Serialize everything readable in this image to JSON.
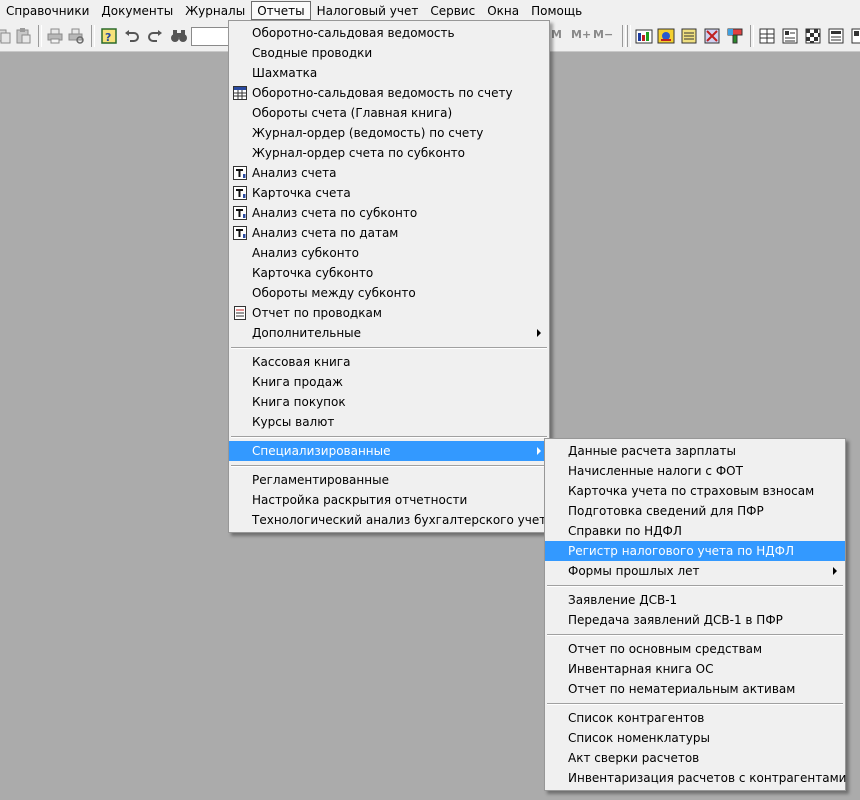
{
  "menubar": {
    "items": [
      {
        "label": "Справочники"
      },
      {
        "label": "Документы"
      },
      {
        "label": "Журналы"
      },
      {
        "label": "Отчеты"
      },
      {
        "label": "Налоговый учет"
      },
      {
        "label": "Сервис"
      },
      {
        "label": "Окна"
      },
      {
        "label": "Помощь"
      }
    ],
    "active": "Отчеты"
  },
  "toolbar": {
    "text_m": "M",
    "text_mplus": "M+",
    "text_mminus": "M−"
  },
  "reports_menu": {
    "items": [
      {
        "label": "Оборотно-сальдовая ведомость"
      },
      {
        "label": "Сводные проводки"
      },
      {
        "label": "Шахматка"
      },
      {
        "label": "Оборотно-сальдовая ведомость по счету",
        "icon": "table-icon"
      },
      {
        "label": "Обороты счета (Главная книга)"
      },
      {
        "label": "Журнал-ордер (ведомость) по счету"
      },
      {
        "label": "Журнал-ордер счета по субконто"
      },
      {
        "label": "Анализ счета",
        "icon": "report-t-icon"
      },
      {
        "label": "Карточка счета",
        "icon": "report-t-icon"
      },
      {
        "label": "Анализ счета по субконто",
        "icon": "report-t-icon"
      },
      {
        "label": "Анализ счета по датам",
        "icon": "report-t-icon"
      },
      {
        "label": "Анализ субконто"
      },
      {
        "label": "Карточка субконто"
      },
      {
        "label": "Обороты между субконто"
      },
      {
        "label": "Отчет по проводкам",
        "icon": "document-icon"
      },
      {
        "label": "Дополнительные",
        "submenu": true
      },
      {
        "separator": true
      },
      {
        "label": "Кассовая книга"
      },
      {
        "label": "Книга продаж"
      },
      {
        "label": "Книга покупок"
      },
      {
        "label": "Курсы валют"
      },
      {
        "separator": true
      },
      {
        "label": "Специализированные",
        "submenu": true,
        "selected": true
      },
      {
        "separator": true
      },
      {
        "label": "Регламентированные"
      },
      {
        "label": "Настройка раскрытия отчетности"
      },
      {
        "label": "Технологический анализ бухгалтерского учета"
      }
    ]
  },
  "specialized_menu": {
    "items": [
      {
        "label": "Данные расчета зарплаты"
      },
      {
        "label": "Начисленные налоги с ФОТ"
      },
      {
        "label": "Карточка учета по страховым взносам"
      },
      {
        "label": "Подготовка сведений для ПФР"
      },
      {
        "label": "Справки по НДФЛ"
      },
      {
        "label": "Регистр налогового учета по НДФЛ",
        "selected": true
      },
      {
        "label": "Формы прошлых лет",
        "submenu": true
      },
      {
        "separator": true
      },
      {
        "label": "Заявление ДСВ-1"
      },
      {
        "label": "Передача заявлений ДСВ-1 в ПФР"
      },
      {
        "separator": true
      },
      {
        "label": "Отчет по основным средствам"
      },
      {
        "label": "Инвентарная книга ОС"
      },
      {
        "label": "Отчет по нематериальным активам"
      },
      {
        "separator": true
      },
      {
        "label": "Список контрагентов"
      },
      {
        "label": "Список номенклатуры"
      },
      {
        "label": "Акт сверки расчетов"
      },
      {
        "label": "Инвентаризация расчетов с контрагентами"
      }
    ]
  },
  "colors": {
    "highlight": "#3399ff",
    "workspace": "#ababab",
    "menu_bg": "#f0f0f0"
  }
}
